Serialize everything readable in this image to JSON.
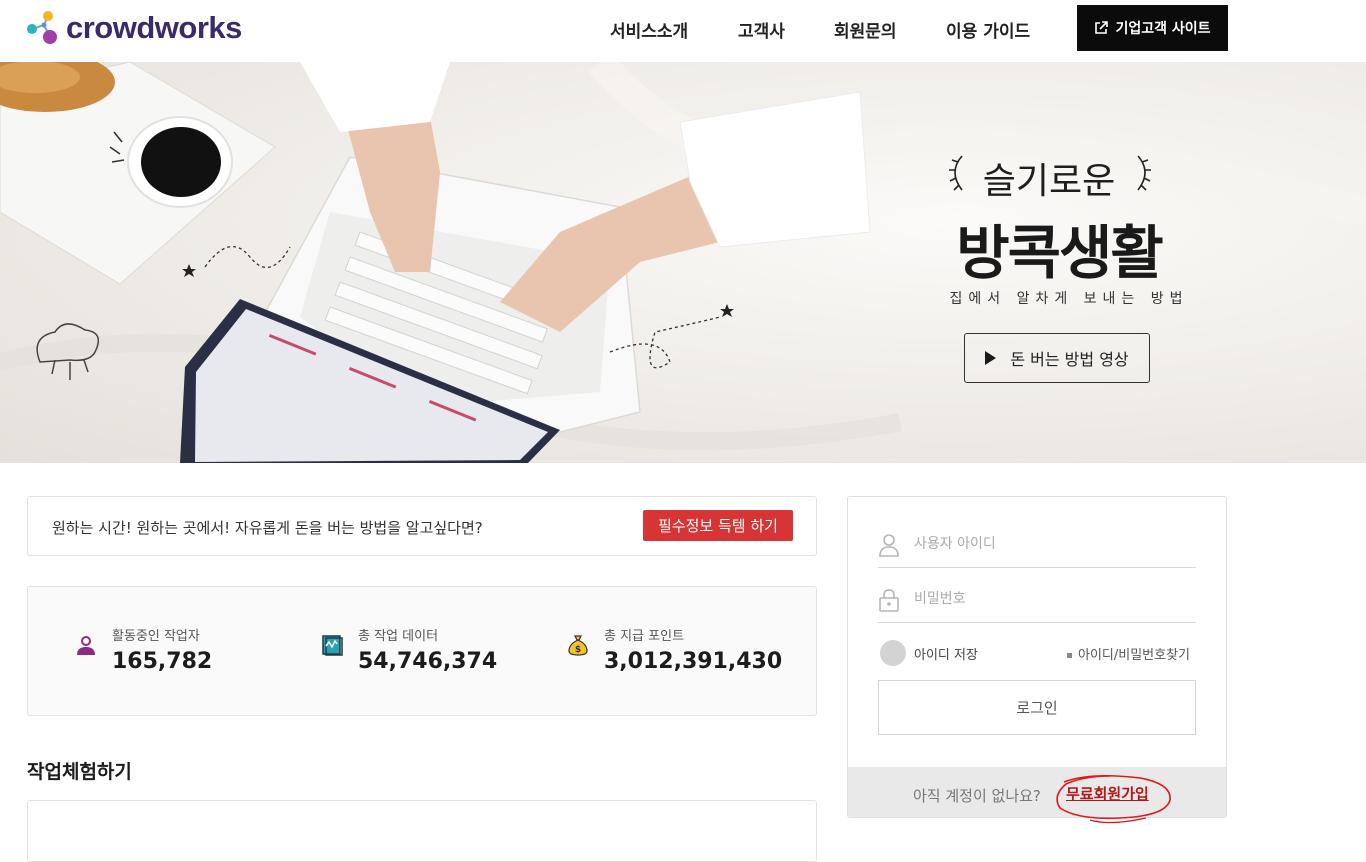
{
  "header": {
    "logo_text": "crowdworks",
    "nav": [
      "서비스소개",
      "고객사",
      "회원문의",
      "이용 가이드"
    ],
    "corp_button": "기업고객 사이트"
  },
  "hero": {
    "subtitle": "슬기로운",
    "title": "방콕생활",
    "description": "집에서 알차게 보내는 방법",
    "video_button": "돈 버는 방법 영상"
  },
  "info_bar": {
    "text": "원하는 시간! 원하는 곳에서! 자유롭게 돈을 버는 방법을 알고싶다면?",
    "button": "필수정보 득템 하기"
  },
  "stats": [
    {
      "icon": "worker-icon",
      "label": "활동중인 작업자",
      "value": "165,782"
    },
    {
      "icon": "data-book-icon",
      "label": "총 작업 데이터",
      "value": "54,746,374"
    },
    {
      "icon": "money-bag-icon",
      "label": "총 지급 포인트",
      "value": "3,012,391,430"
    }
  ],
  "trial": {
    "title": "작업체험하기"
  },
  "login": {
    "username_placeholder": "사용자 아이디",
    "password_placeholder": "비밀번호",
    "remember_label": "아이디 저장",
    "find_link": "아이디/비밀번호찾기",
    "login_button": "로그인",
    "no_account_text": "아직 계정이 없나요?",
    "signup_link": "무료회원가입"
  },
  "colors": {
    "accent_red": "#d73535",
    "brand_purple": "#3a2a6c",
    "dark": "#0b0b0b"
  }
}
